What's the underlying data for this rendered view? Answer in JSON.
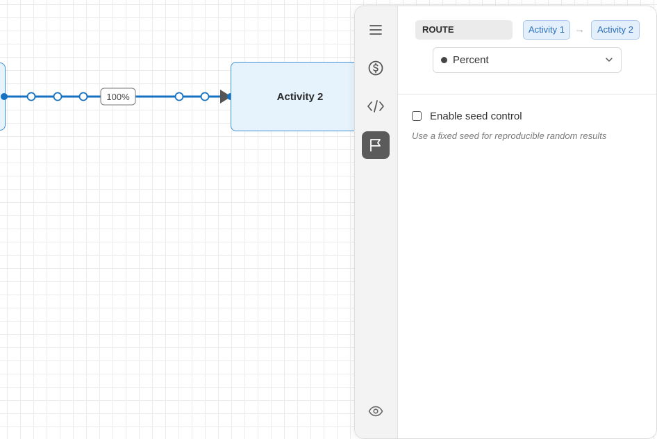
{
  "canvas": {
    "nodes": [
      {
        "id": "left",
        "label": ""
      },
      {
        "id": "activity2",
        "label": "Activity 2"
      }
    ],
    "edge": {
      "label": "100%"
    }
  },
  "panel": {
    "rail_icons": [
      "menu-icon",
      "dollar-icon",
      "code-icon",
      "flag-icon",
      "eye-icon"
    ],
    "active_rail": "flag-icon",
    "route_label": "ROUTE",
    "route_from": "Activity 1",
    "route_to": "Activity 2",
    "arrow": "→",
    "split_mode": {
      "value": "Percent"
    },
    "seed_control": {
      "label": "Enable seed control",
      "checked": false,
      "hint": "Use a fixed seed for reproducible random results"
    }
  },
  "colors": {
    "edge": "#1572c1",
    "node_fill": "#e6f2fc",
    "node_border": "#3e8fd3",
    "chip_text": "#2c6fbb",
    "active_rail": "#5b5b5b"
  }
}
